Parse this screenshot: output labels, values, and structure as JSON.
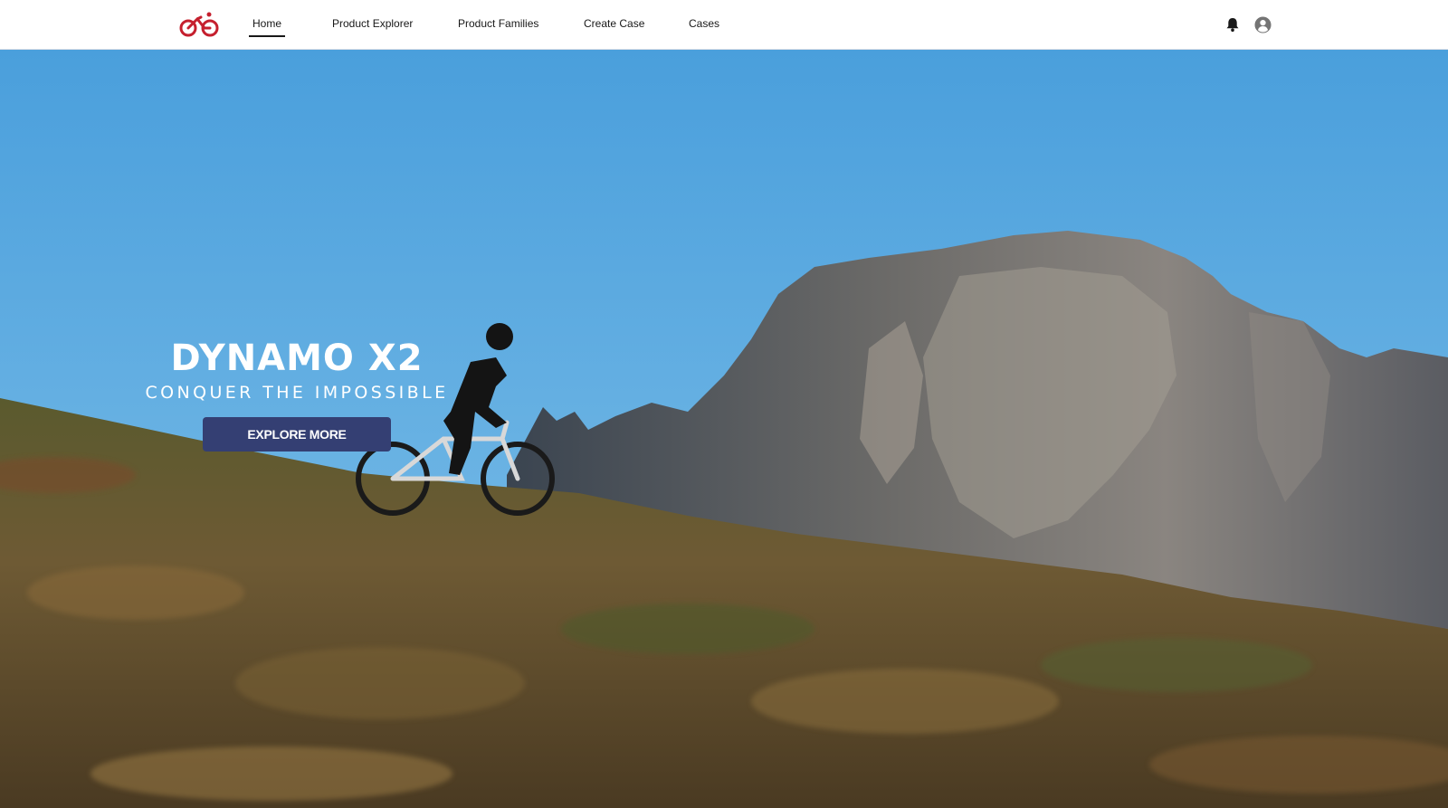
{
  "nav": {
    "items": [
      {
        "label": "Home",
        "active": true
      },
      {
        "label": "Product Explorer",
        "active": false
      },
      {
        "label": "Product Families",
        "active": false
      },
      {
        "label": "Create Case",
        "active": false
      },
      {
        "label": "Cases",
        "active": false
      }
    ],
    "icons": {
      "logo": "bike-logo-icon",
      "notifications": "bell-icon",
      "profile": "user-avatar-icon"
    }
  },
  "hero": {
    "title": "DYNAMO X2",
    "subtitle": "CONQUER THE IMPOSSIBLE",
    "button_label": "EXPLORE MORE"
  },
  "colors": {
    "brand_red": "#c5202e",
    "button": "#343f73",
    "sky": "#5aa9e0"
  }
}
